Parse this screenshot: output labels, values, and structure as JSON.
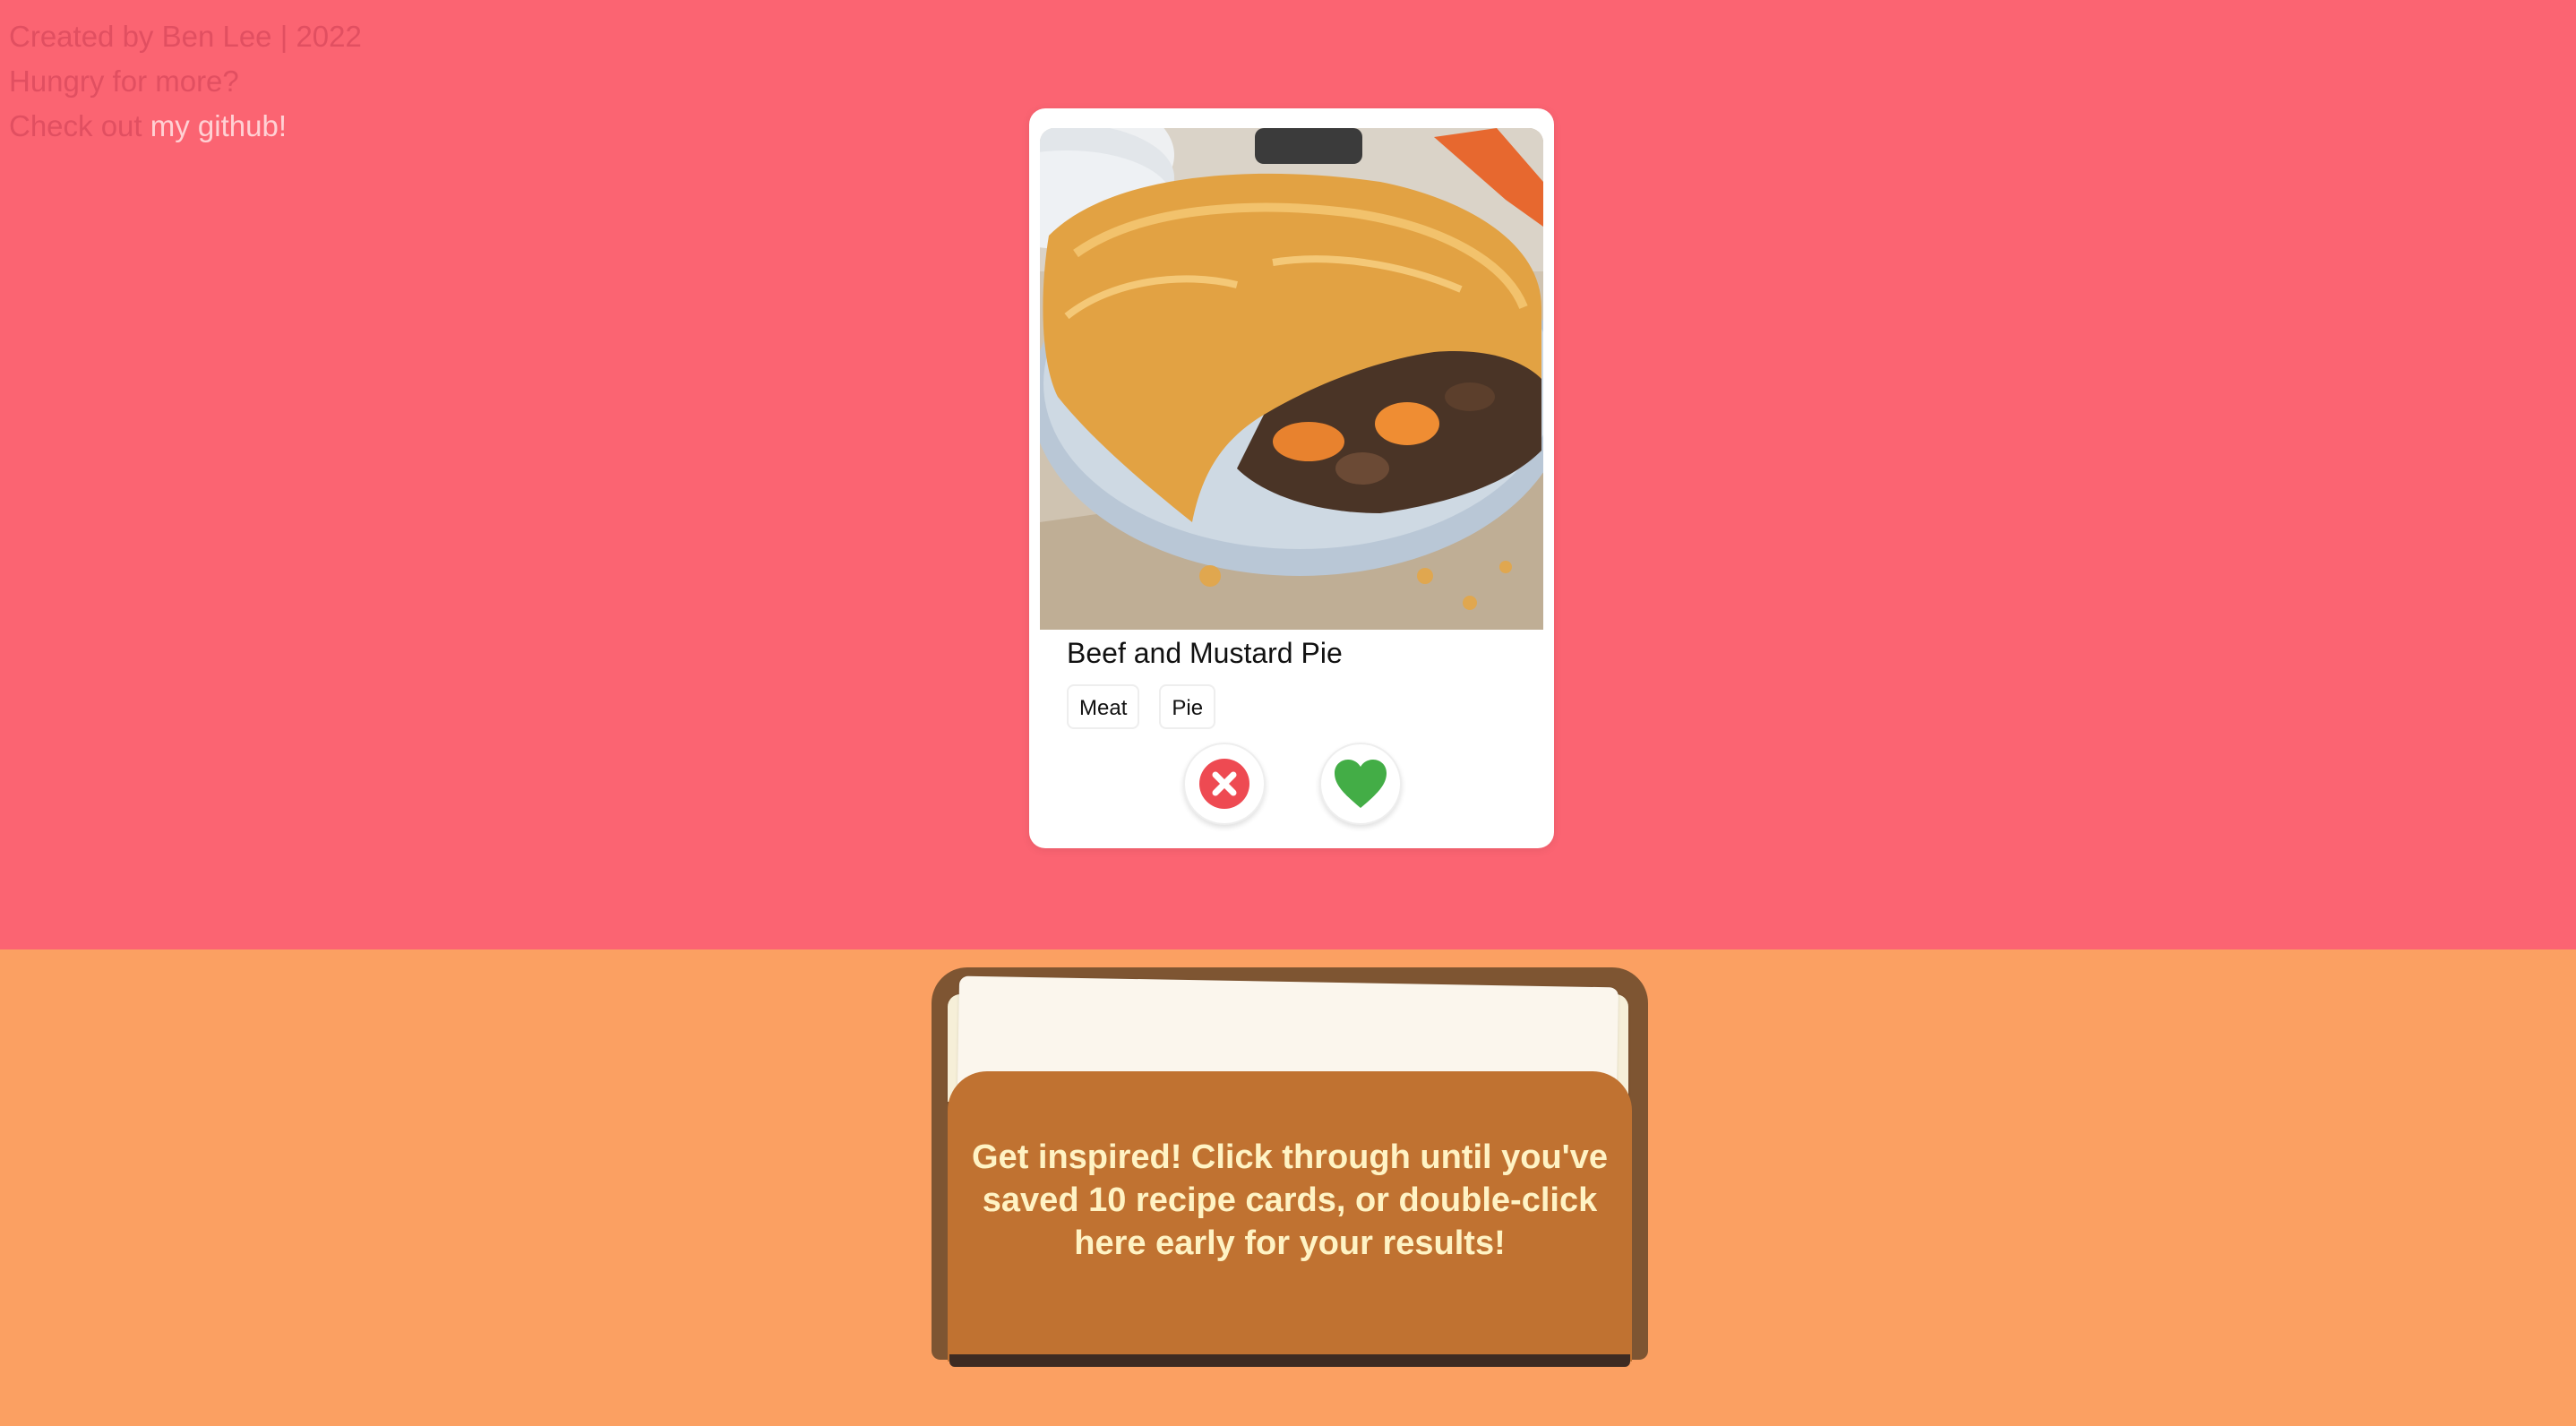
{
  "credits": {
    "line1": "Created by Ben Lee | 2022",
    "line2": "Hungry for more?",
    "line3_prefix": "Check out ",
    "github_link": "my github!"
  },
  "recipe_card": {
    "title": "Beef and Mustard Pie",
    "tags": [
      "Meat",
      "Pie"
    ],
    "reject_icon": "x-circle-icon",
    "like_icon": "heart-icon"
  },
  "card_box": {
    "message": "Get inspired! Click through until you've saved 10 recipe cards, or double-click here early for your results!"
  },
  "colors": {
    "top_background": "#fb6472",
    "bottom_background": "#fba062",
    "reject": "#ee4a52",
    "like": "#43ad46",
    "box_front": "#c07231",
    "box_back": "#7e5532"
  }
}
